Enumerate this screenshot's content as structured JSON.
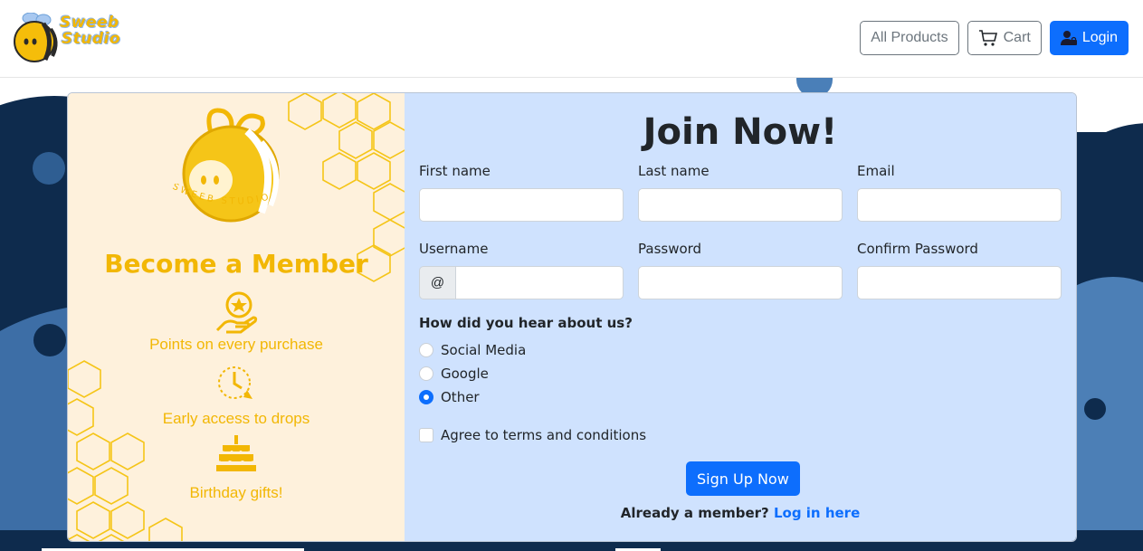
{
  "brand": {
    "logo_line1": "Sweeb",
    "logo_line2": "Studio"
  },
  "nav": {
    "all_products": "All Products",
    "cart": "Cart",
    "login": "Login"
  },
  "promo": {
    "emblem_text": "SWEEB STUDIO",
    "title": "Become a Member",
    "benefits": [
      {
        "icon": "star-hand-icon",
        "label": "Points on every purchase"
      },
      {
        "icon": "clock-icon",
        "label": "Early access to drops"
      },
      {
        "icon": "cake-icon",
        "label": "Birthday gifts!"
      }
    ]
  },
  "form": {
    "title": "Join Now!",
    "fields": {
      "first_name": "First name",
      "last_name": "Last name",
      "email": "Email",
      "username": "Username",
      "username_addon": "@",
      "password": "Password",
      "confirm_password": "Confirm Password"
    },
    "question": "How did you hear about us?",
    "options": [
      {
        "label": "Social Media",
        "checked": false
      },
      {
        "label": "Google",
        "checked": false
      },
      {
        "label": "Other",
        "checked": true
      }
    ],
    "terms": "Agree to terms and conditions",
    "submit": "Sign Up Now",
    "already_text": "Already a member?",
    "login_link": "Log in here"
  },
  "colors": {
    "accent": "#0d6efd",
    "brand_yellow": "#f2b705",
    "promo_bg": "#fef1dc",
    "form_bg": "#cfe2fe",
    "bg_dark": "#0d2a4a",
    "bg_mid": "#3b6aa0"
  }
}
